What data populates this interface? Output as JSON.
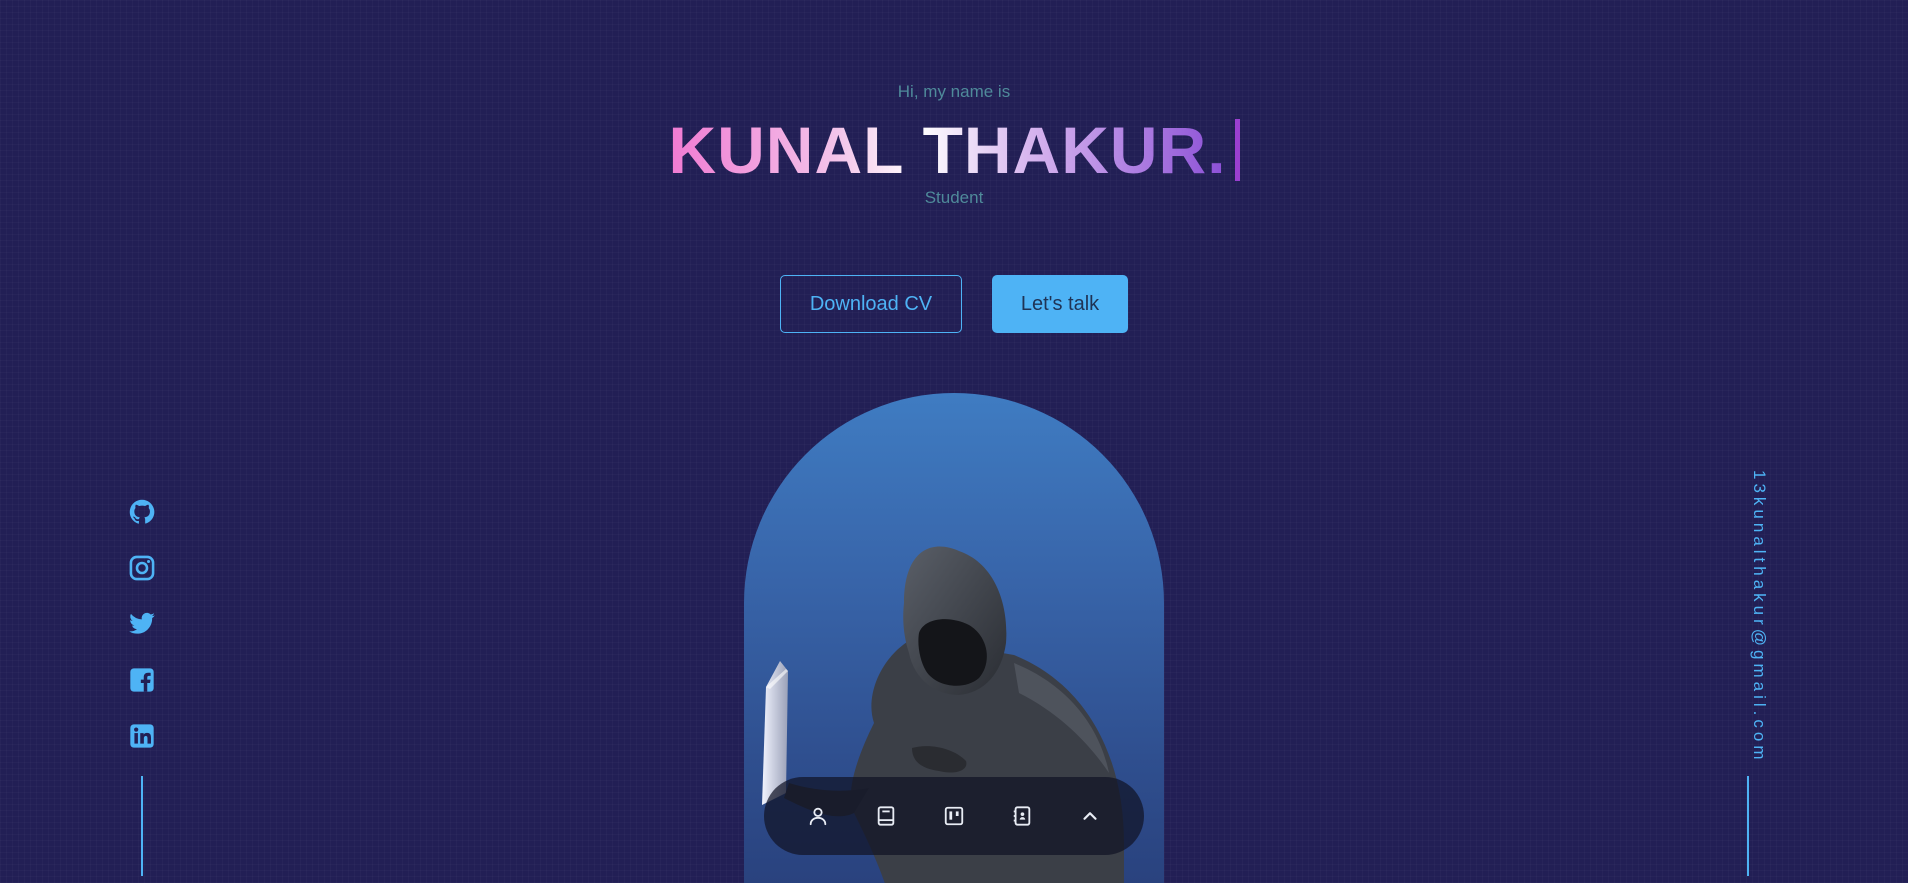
{
  "header": {
    "greeting": "Hi, my name is",
    "name": "KUNAL THAKUR.",
    "role": "Student"
  },
  "cta": {
    "download_cv_label": "Download CV",
    "lets_talk_label": "Let's talk"
  },
  "socials": [
    {
      "icon": "github-icon"
    },
    {
      "icon": "instagram-icon"
    },
    {
      "icon": "twitter-icon"
    },
    {
      "icon": "facebook-icon"
    },
    {
      "icon": "linkedin-icon"
    }
  ],
  "contact": {
    "email": "13kunalthakur@gmail.com"
  },
  "nav": {
    "items": [
      {
        "icon": "user-icon"
      },
      {
        "icon": "book-icon"
      },
      {
        "icon": "kanban-icon"
      },
      {
        "icon": "contact-book-icon"
      },
      {
        "icon": "chevron-up-icon"
      }
    ]
  },
  "colors": {
    "background": "#221f55",
    "accent": "#4eb3f5",
    "muted_text": "#4f8a9a",
    "name_gradient_start": "#f07ad2",
    "name_gradient_end": "#8b4fd6",
    "cursor": "#9a3fd0",
    "nav_background": "#111426"
  }
}
